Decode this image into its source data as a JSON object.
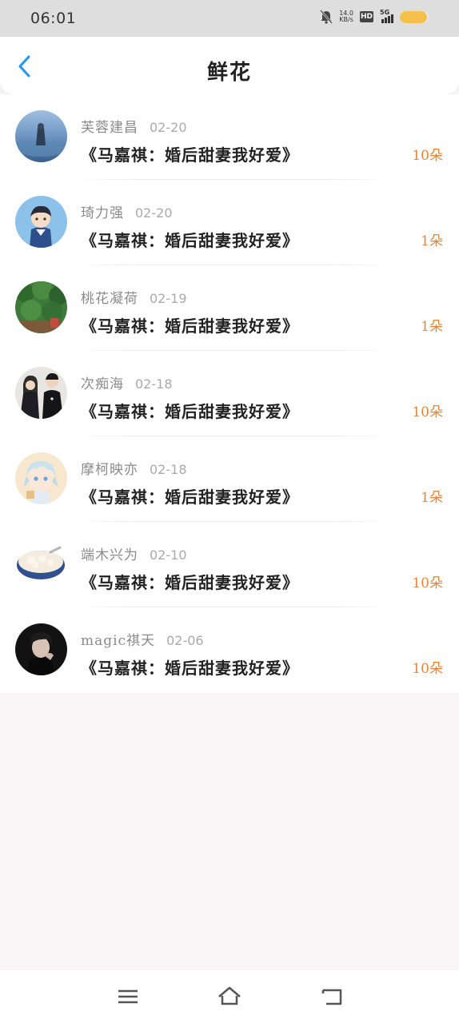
{
  "status": {
    "time": "06:01",
    "net_speed_value": "14.0",
    "net_speed_unit": "KB/s",
    "hd": "HD",
    "network": "5G",
    "battery_level": 0.95
  },
  "header": {
    "title": "鲜花"
  },
  "items": [
    {
      "name": "芙蓉建昌",
      "date": "02-20",
      "book": "《马嘉祺：婚后甜妻我好爱》",
      "count": "10朵"
    },
    {
      "name": "琦力强",
      "date": "02-20",
      "book": "《马嘉祺：婚后甜妻我好爱》",
      "count": "1朵"
    },
    {
      "name": "桃花凝荷",
      "date": "02-19",
      "book": "《马嘉祺：婚后甜妻我好爱》",
      "count": "1朵"
    },
    {
      "name": "次痴海",
      "date": "02-18",
      "book": "《马嘉祺：婚后甜妻我好爱》",
      "count": "10朵"
    },
    {
      "name": "摩柯映亦",
      "date": "02-18",
      "book": "《马嘉祺：婚后甜妻我好爱》",
      "count": "1朵"
    },
    {
      "name": "端木兴为",
      "date": "02-10",
      "book": "《马嘉祺：婚后甜妻我好爱》",
      "count": "10朵"
    },
    {
      "name": "magic祺天",
      "date": "02-06",
      "book": "《马嘉祺：婚后甜妻我好爱》",
      "count": "10朵"
    }
  ],
  "colors": {
    "accent": "#e8853a",
    "back_arrow": "#2196f3"
  }
}
